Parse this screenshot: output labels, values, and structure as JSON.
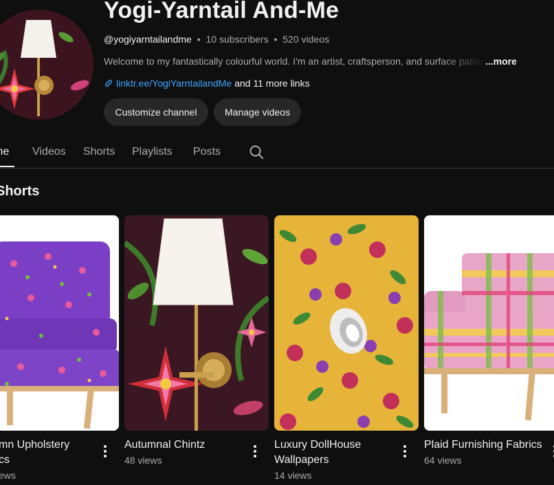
{
  "channel": {
    "name": "Yogi-Yarntail And-Me",
    "handle": "@yogiyarntailandme",
    "subscribers": "10 subscribers",
    "videos": "520 videos",
    "description": "Welcome to my fantastically colourful world. I'm an artist, craftsperson, and surface pattern",
    "more_label": "...more",
    "link_url": "linktr.ee/YogiYarntailandMe",
    "more_links": "and 11 more links"
  },
  "buttons": {
    "customize": "Customize channel",
    "manage": "Manage videos"
  },
  "tabs": [
    "me",
    "Videos",
    "Shorts",
    "Playlists",
    "Posts"
  ],
  "section_title": "Shorts",
  "shorts": [
    {
      "title_line1": "mn Upholstery",
      "title_line2": "cs",
      "views": "ews"
    },
    {
      "title_line1": "Autumnal Chintz",
      "title_line2": "",
      "views": "48 views"
    },
    {
      "title_line1": "Luxury DollHouse",
      "title_line2": "Wallpapers",
      "views": "14 views"
    },
    {
      "title_line1": "Plaid Furnishing Fabrics",
      "title_line2": "",
      "views": "64 views"
    }
  ],
  "colors": {
    "background": "#0f0f0f",
    "button_bg": "#272727",
    "link": "#3ea6ff",
    "secondary_text": "#aaaaaa"
  }
}
